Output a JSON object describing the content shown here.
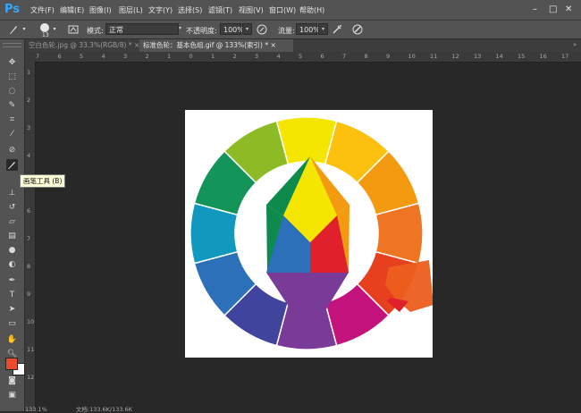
{
  "app": {
    "logo": "Ps"
  },
  "menu": [
    "文件(F)",
    "编辑(E)",
    "图像(I)",
    "图层(L)",
    "文字(Y)",
    "选择(S)",
    "滤镜(T)",
    "视图(V)",
    "窗口(W)",
    "帮助(H)"
  ],
  "window_controls": {
    "minimize": "–",
    "maximize": "□",
    "close": "✕"
  },
  "options": {
    "brush_size": "13",
    "mode_label": "模式:",
    "mode_value": "正常",
    "opacity_label": "不透明度:",
    "opacity_value": "100%",
    "flow_label": "流量:",
    "flow_value": "100%"
  },
  "tabs": [
    {
      "label": "空白色轮.jpg @ 33.3%(RGB/8) *",
      "close": "×"
    },
    {
      "label": "标准色轮：基本色组.gif @ 133%(索引) *",
      "close": "×"
    }
  ],
  "ruler_top_labels": [
    "7",
    "6",
    "5",
    "4",
    "3",
    "2",
    "1",
    "0",
    "1",
    "2",
    "3",
    "4",
    "5",
    "6",
    "7",
    "8",
    "9",
    "10",
    "11",
    "12",
    "13",
    "14",
    "15",
    "16",
    "17"
  ],
  "ruler_left_labels": [
    "1",
    "2",
    "3",
    "4",
    "5",
    "6",
    "7",
    "8",
    "9",
    "10",
    "11",
    "12"
  ],
  "tooltip": "画笔工具 (B)",
  "status": {
    "zoom": "133.1%",
    "doc": "文档:133.6K/133.6K"
  },
  "colors": {
    "foreground": "#ee4a2c",
    "background": "#ffffff",
    "ps_blue": "#31a8ff"
  }
}
